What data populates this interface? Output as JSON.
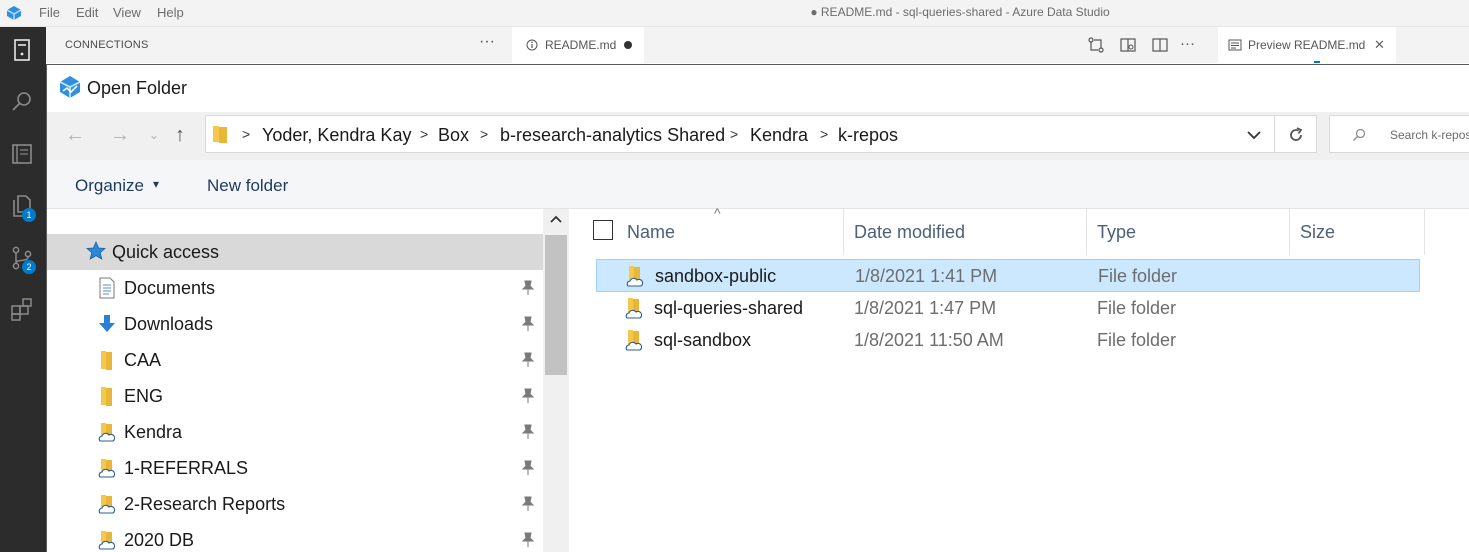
{
  "app": {
    "menu": [
      "File",
      "Edit",
      "View",
      "Help"
    ],
    "window_title": "● README.md - sql-queries-shared - Azure Data Studio"
  },
  "activity_bar": {
    "icons": [
      "servers-icon",
      "search-icon",
      "notebook-icon",
      "explorer-icon",
      "source-control-icon",
      "extensions-icon"
    ],
    "badges": {
      "explorer": "1",
      "source_control": "2"
    },
    "accent_color": "#007acc"
  },
  "sidebar": {
    "title": "CONNECTIONS",
    "more": "···"
  },
  "tabs": {
    "editor_tab": {
      "label": "README.md",
      "dirty": true
    },
    "preview_tab": {
      "label": "Preview README.md",
      "close": "✕"
    },
    "more": "···"
  },
  "dialog": {
    "title": "Open Folder",
    "breadcrumbs": [
      "Yoder, Kendra Kay",
      "Box",
      "b-research-analytics Shared",
      "Kendra",
      "k-repos"
    ],
    "search_placeholder": "Search k-repos",
    "commands": {
      "organize": "Organize",
      "organize_caret": "▾",
      "new_folder": "New folder"
    },
    "nav_pane": {
      "quick_access": "Quick access",
      "items": [
        {
          "label": "Documents",
          "icon": "documents-icon"
        },
        {
          "label": "Downloads",
          "icon": "downloads-icon"
        },
        {
          "label": "CAA",
          "icon": "folder-icon"
        },
        {
          "label": "ENG",
          "icon": "folder-icon"
        },
        {
          "label": "Kendra",
          "icon": "cloud-folder-icon"
        },
        {
          "label": "1-REFERRALS",
          "icon": "cloud-folder-icon"
        },
        {
          "label": "2-Research Reports",
          "icon": "cloud-folder-icon"
        },
        {
          "label": "2020 DB",
          "icon": "cloud-folder-icon"
        }
      ]
    },
    "columns": {
      "name": "Name",
      "date": "Date modified",
      "type": "Type",
      "size": "Size"
    },
    "files": [
      {
        "name": "sandbox-public",
        "date": "1/8/2021 1:41 PM",
        "type": "File folder",
        "selected": true
      },
      {
        "name": "sql-queries-shared",
        "date": "1/8/2021 1:47 PM",
        "type": "File folder",
        "selected": false
      },
      {
        "name": "sql-sandbox",
        "date": "1/8/2021 11:50 AM",
        "type": "File folder",
        "selected": false
      }
    ],
    "colors": {
      "selection": "#cce8ff",
      "selection_border": "#99d1ff",
      "nav_selected": "#d9d9d9"
    }
  }
}
